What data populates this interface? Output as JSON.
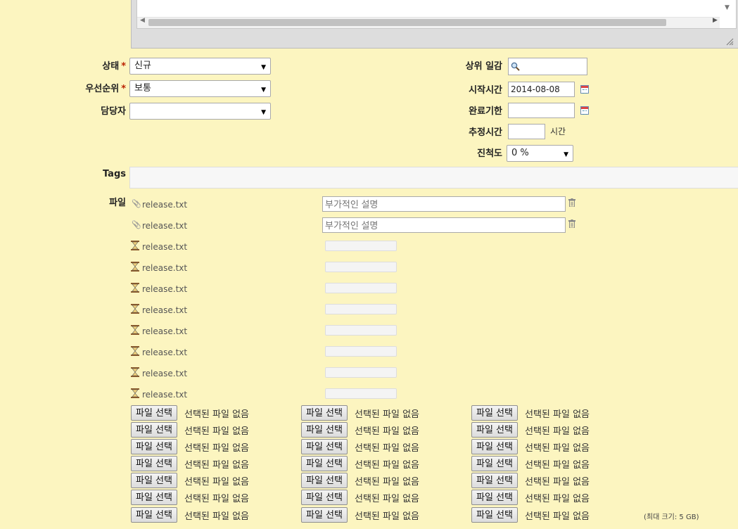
{
  "form": {
    "status": {
      "label": "상태",
      "required": "*",
      "value": "신규"
    },
    "priority": {
      "label": "우선순위",
      "required": "*",
      "value": "보통"
    },
    "assignee": {
      "label": "담당자",
      "value": ""
    },
    "parent_task": {
      "label": "상위 일감",
      "value": ""
    },
    "start_date": {
      "label": "시작시간",
      "value": "2014-08-08"
    },
    "due_date": {
      "label": "완료기한",
      "value": ""
    },
    "estimated_time": {
      "label": "추정시간",
      "value": "",
      "unit": "시간"
    },
    "done_ratio": {
      "label": "진척도",
      "value": "0 %"
    },
    "tags": {
      "label": "Tags",
      "value": ""
    }
  },
  "files": {
    "label": "파일",
    "attached": [
      {
        "name": "release.txt",
        "description_placeholder": "부가적인 설명"
      },
      {
        "name": "release.txt",
        "description_placeholder": "부가적인 설명"
      }
    ],
    "uploading": [
      {
        "name": "release.txt"
      },
      {
        "name": "release.txt"
      },
      {
        "name": "release.txt"
      },
      {
        "name": "release.txt"
      },
      {
        "name": "release.txt"
      },
      {
        "name": "release.txt"
      },
      {
        "name": "release.txt"
      },
      {
        "name": "release.txt"
      }
    ],
    "choose_button_label": "파일 선택",
    "no_file_text": "선택된 파일 없음",
    "max_size": "(최대 크기: 5 GB)"
  },
  "icons": {
    "attachment": "paperclip-icon",
    "uploading": "hourglass-icon",
    "delete": "trash-icon",
    "calendar": "calendar-icon",
    "search": "magnifier-icon"
  },
  "colors": {
    "background": "#fcf5c0",
    "required": "#bb2200"
  }
}
